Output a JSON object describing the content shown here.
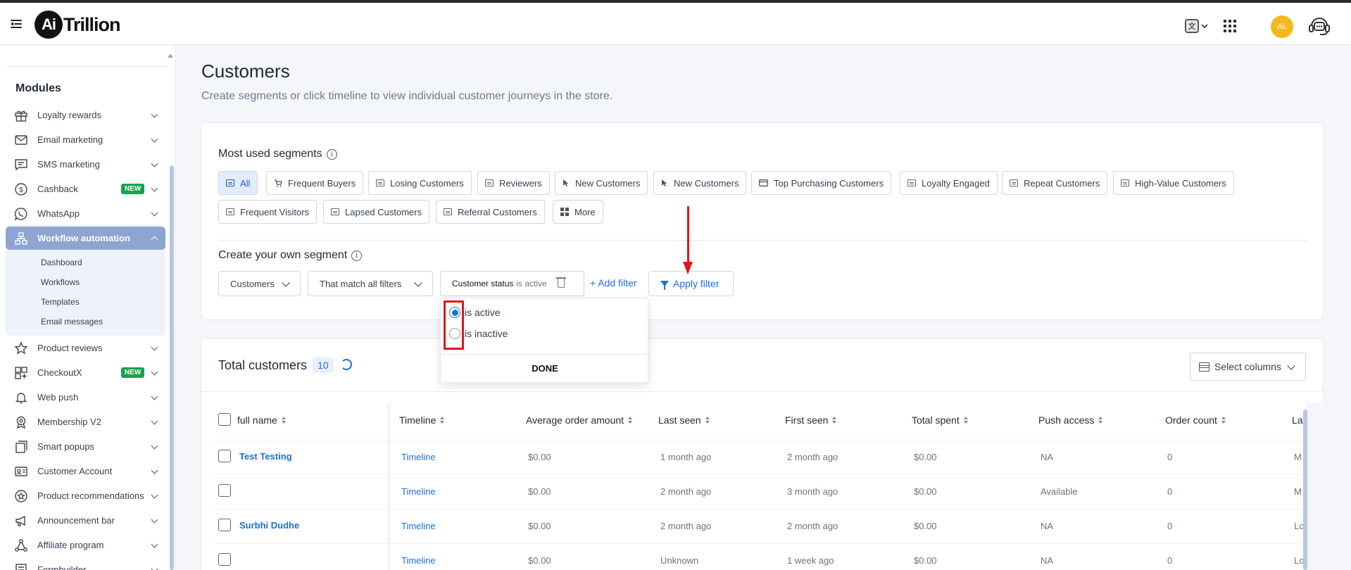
{
  "brand": {
    "logo_mark": "Ai",
    "logo_text": "Trillion"
  },
  "topbar": {
    "avatar_initials": "AL",
    "translate_glyph": "文"
  },
  "sidebar": {
    "modules_heading": "Modules",
    "items": [
      {
        "label": "Loyalty rewards",
        "icon": "gift-icon"
      },
      {
        "label": "Email marketing",
        "icon": "mail-icon"
      },
      {
        "label": "SMS marketing",
        "icon": "chat-icon"
      },
      {
        "label": "Cashback",
        "icon": "cashback-icon",
        "badge": "NEW"
      },
      {
        "label": "WhatsApp",
        "icon": "whatsapp-icon"
      },
      {
        "label": "Workflow automation",
        "icon": "workflow-icon",
        "active": true
      },
      {
        "label": "Product reviews",
        "icon": "star-icon"
      },
      {
        "label": "CheckoutX",
        "icon": "checkout-icon",
        "badge": "NEW"
      },
      {
        "label": "Web push",
        "icon": "bell-icon"
      },
      {
        "label": "Membership V2",
        "icon": "badge-icon"
      },
      {
        "label": "Smart popups",
        "icon": "popup-icon"
      },
      {
        "label": "Customer Account",
        "icon": "id-card-icon"
      },
      {
        "label": "Product recommendations",
        "icon": "recommend-icon"
      },
      {
        "label": "Announcement bar",
        "icon": "megaphone-icon"
      },
      {
        "label": "Affiliate program",
        "icon": "network-icon"
      },
      {
        "label": "Formbuilder",
        "icon": "form-icon"
      }
    ],
    "workflow_subitems": [
      "Dashboard",
      "Workflows",
      "Templates",
      "Email messages"
    ]
  },
  "page": {
    "title": "Customers",
    "subtitle": "Create segments or click timeline to view individual customer journeys in the store."
  },
  "segments": {
    "heading": "Most used segments",
    "chips": [
      "All",
      "Frequent Buyers",
      "Losing Customers",
      "Reviewers",
      "New Customers",
      "New Customers",
      "Top Purchasing Customers",
      "Loyalty Engaged",
      "Repeat Customers",
      "High-Value Customers",
      "Frequent Visitors",
      "Lapsed Customers",
      "Referral Customers",
      "More"
    ],
    "selected": "All"
  },
  "builder": {
    "heading": "Create your own segment",
    "entity_select": "Customers",
    "match_select": "That match all filters",
    "filter_field": "Customer status",
    "filter_value": "is active",
    "add_filter": "+ Add filter",
    "apply_filter": "Apply filter"
  },
  "status_popup": {
    "options": [
      "is active",
      "is inactive"
    ],
    "selected": "is active",
    "done": "DONE"
  },
  "table": {
    "title": "Total customers",
    "count": "10",
    "select_columns": "Select columns",
    "columns": [
      "full name",
      "Timeline",
      "Average order amount",
      "Last seen",
      "First seen",
      "Total spent",
      "Push access",
      "Order count",
      "La"
    ],
    "rows": [
      {
        "name": "Test Testing",
        "timeline": "Timeline",
        "avg": "$0.00",
        "last_seen": "1 month ago",
        "first_seen": "2 month ago",
        "spent": "$0.00",
        "push": "NA",
        "orders": "0",
        "last": "M"
      },
      {
        "name": "",
        "timeline": "Timeline",
        "avg": "$0.00",
        "last_seen": "2 month ago",
        "first_seen": "3 month ago",
        "spent": "$0.00",
        "push": "Available",
        "orders": "0",
        "last": "M"
      },
      {
        "name": "Surbhi Dudhe",
        "timeline": "Timeline",
        "avg": "$0.00",
        "last_seen": "2 month ago",
        "first_seen": "2 month ago",
        "spent": "$0.00",
        "push": "NA",
        "orders": "0",
        "last": "Lo"
      },
      {
        "name": "",
        "timeline": "Timeline",
        "avg": "$0.00",
        "last_seen": "Unknown",
        "first_seen": "1 week ago",
        "spent": "$0.00",
        "push": "NA",
        "orders": "0",
        "last": "Lo"
      }
    ]
  },
  "colors": {
    "accent": "#1d6fd8",
    "sidebar_active": "#8ea5d1",
    "badge_new": "#16a34a",
    "annotation": "#e5141a",
    "avatar": "#f5b81c"
  }
}
